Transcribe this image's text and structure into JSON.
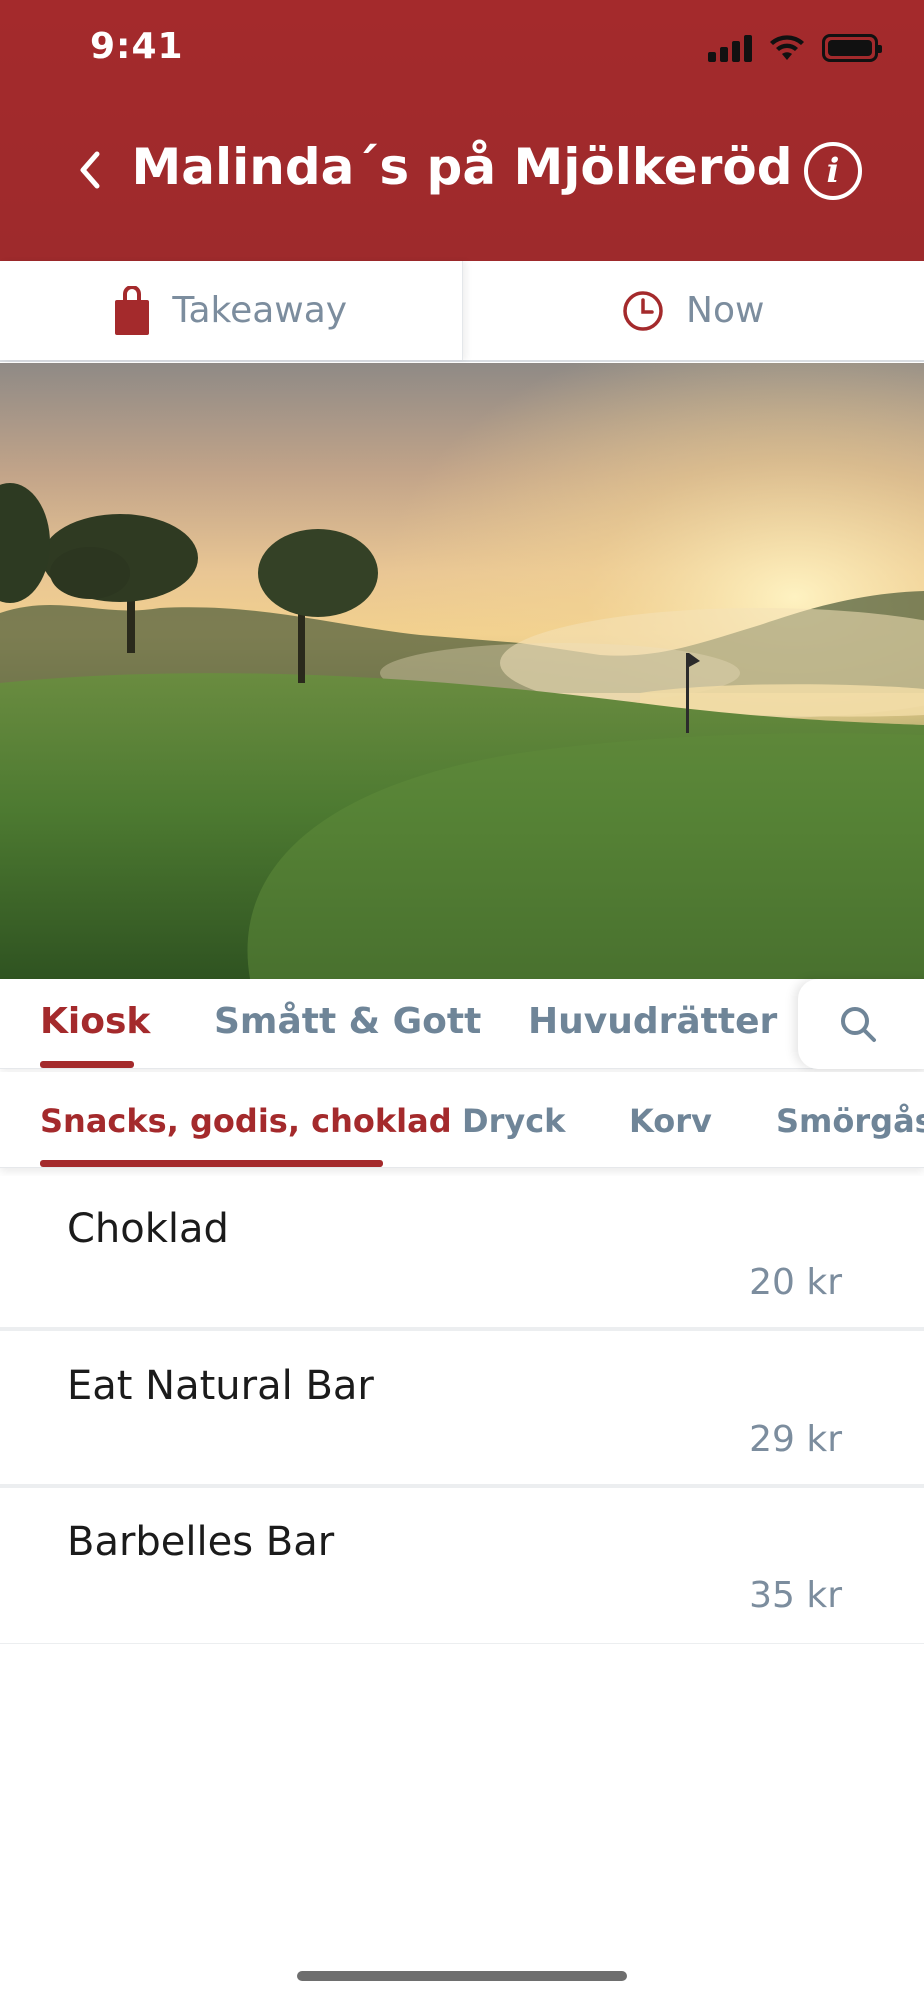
{
  "status_bar": {
    "time": "9:41"
  },
  "header": {
    "title": "Malinda´s på Mjölkeröd"
  },
  "mode_bar": {
    "takeaway_label": "Takeaway",
    "time_label": "Now"
  },
  "tabs": [
    {
      "label": "Kiosk",
      "active": true
    },
    {
      "label": "Smått & Gott",
      "active": false
    },
    {
      "label": "Huvudrätter",
      "active": false
    }
  ],
  "subtabs": [
    {
      "label": "Snacks, godis, choklad",
      "active": true
    },
    {
      "label": "Dryck",
      "active": false
    },
    {
      "label": "Korv",
      "active": false
    },
    {
      "label": "Smörgåsar",
      "active": false
    }
  ],
  "items": [
    {
      "name": "Choklad",
      "price": "20 kr"
    },
    {
      "name": "Eat Natural Bar",
      "price": "29 kr"
    },
    {
      "name": "Barbelles Bar",
      "price": "35 kr"
    }
  ],
  "colors": {
    "brand": "#a42a2c",
    "muted_text": "#7c8d9e"
  }
}
